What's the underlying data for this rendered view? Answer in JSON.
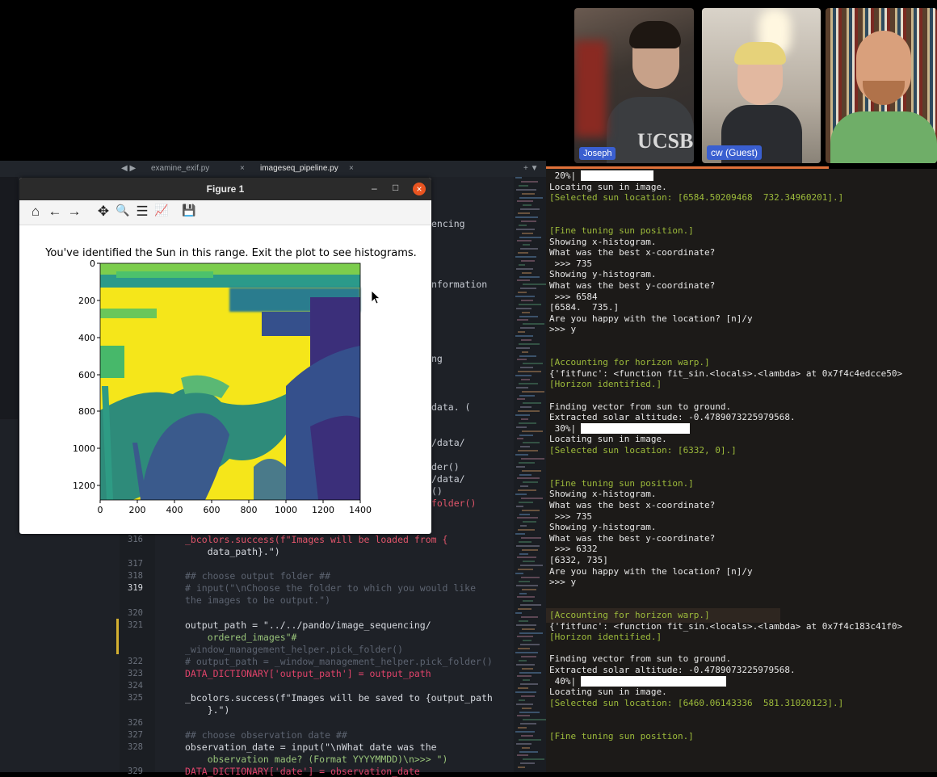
{
  "video_call": {
    "participants": [
      {
        "name": "Joseph"
      },
      {
        "name": "cw (Guest)"
      },
      {
        "name": ""
      }
    ],
    "shirt_text": "UCSB"
  },
  "editor": {
    "tabs": [
      {
        "label": "examine_exif.py",
        "close": "×"
      },
      {
        "label": "imageseq_pipeline.py",
        "close": "×"
      }
    ],
    "tab_nav": "◀ ▶",
    "tab_actions": "+ ▼",
    "fragments": [
      "encing",
      "nformation",
      "ng",
      "data. (",
      "/data/",
      "der()",
      "/data/",
      "()",
      "folder()"
    ],
    "lines": [
      {
        "num": "316",
        "code": "_bcolors.success(f\"Images will be loaded from {"
      },
      {
        "num": "",
        "code": "    data_path}.\")"
      },
      {
        "num": "317",
        "code": ""
      },
      {
        "num": "318",
        "code": "## choose output folder ##"
      },
      {
        "num": "319",
        "code": "# input(\"\\nChoose the folder to which you would like"
      },
      {
        "num": "",
        "code": "the images to be output.\")"
      },
      {
        "num": "320",
        "code": ""
      },
      {
        "num": "321",
        "code": "output_path = \"../../pando/image_sequencing/"
      },
      {
        "num": "",
        "code": "    ordered_images\"#"
      },
      {
        "num": "",
        "code": "_window_management_helper.pick_folder()"
      },
      {
        "num": "322",
        "code": "# output_path = _window_management_helper.pick_folder()"
      },
      {
        "num": "323",
        "code": "DATA_DICTIONARY['output_path'] = output_path"
      },
      {
        "num": "324",
        "code": ""
      },
      {
        "num": "325",
        "code": "_bcolors.success(f\"Images will be saved to {output_path"
      },
      {
        "num": "",
        "code": "    }.\")"
      },
      {
        "num": "326",
        "code": ""
      },
      {
        "num": "327",
        "code": "## choose observation date ##"
      },
      {
        "num": "328",
        "code": "observation_date = input(\"\\nWhat date was the"
      },
      {
        "num": "",
        "code": "    observation made? (Format YYYYMMDD)\\n>>> \")"
      },
      {
        "num": "329",
        "code": "DATA_DICTIONARY['date'] = observation_date"
      }
    ]
  },
  "figure": {
    "window_title": "Figure 1",
    "controls": {
      "minimize": "–",
      "maximize": "□",
      "close": "×"
    },
    "toolbar": [
      {
        "name": "home-icon",
        "glyph": "⌂"
      },
      {
        "name": "back-icon",
        "glyph": "←"
      },
      {
        "name": "forward-icon",
        "glyph": "→"
      },
      {
        "name": "pan-icon",
        "glyph": "✥"
      },
      {
        "name": "zoom-icon",
        "glyph": "🔍"
      },
      {
        "name": "configure-subplots-icon",
        "glyph": "☰"
      },
      {
        "name": "edit-axis-icon",
        "glyph": "📈"
      },
      {
        "name": "save-icon",
        "glyph": "💾"
      }
    ],
    "plot_title": "You've identified the Sun in this range. Exit the plot to see histograms.",
    "x_ticks": [
      "0",
      "200",
      "400",
      "600",
      "800",
      "1000",
      "1200",
      "1400"
    ],
    "y_ticks": [
      "0",
      "200",
      "400",
      "600",
      "800",
      "1000",
      "1200"
    ]
  },
  "terminal": {
    "lines": [
      {
        "text": " 20%|",
        "type": "progress",
        "percent": 20
      },
      {
        "text": "Locating sun in image.",
        "type": "normal"
      },
      {
        "text": "[Selected sun location: [6584.50209468  732.34960201].]",
        "type": "green"
      },
      {
        "text": "",
        "type": "normal"
      },
      {
        "text": "",
        "type": "normal"
      },
      {
        "text": "[Fine tuning sun position.]",
        "type": "green"
      },
      {
        "text": "Showing x-histogram.",
        "type": "normal"
      },
      {
        "text": "What was the best x-coordinate?",
        "type": "normal"
      },
      {
        "text": " >>> 735",
        "type": "normal"
      },
      {
        "text": "Showing y-histogram.",
        "type": "normal"
      },
      {
        "text": "What was the best y-coordinate?",
        "type": "normal"
      },
      {
        "text": " >>> 6584",
        "type": "normal"
      },
      {
        "text": "[6584.  735.]",
        "type": "normal"
      },
      {
        "text": "Are you happy with the location? [n]/y",
        "type": "normal"
      },
      {
        "text": ">>> y",
        "type": "normal"
      },
      {
        "text": "",
        "type": "normal"
      },
      {
        "text": "",
        "type": "normal"
      },
      {
        "text": "[Accounting for horizon warp.]",
        "type": "green"
      },
      {
        "text": "{'fitfunc': <function fit_sin.<locals>.<lambda> at 0x7f4c4edcce50>",
        "type": "normal"
      },
      {
        "text": "[Horizon identified.]",
        "type": "green"
      },
      {
        "text": "",
        "type": "normal"
      },
      {
        "text": "Finding vector from sun to ground.",
        "type": "normal"
      },
      {
        "text": "Extracted solar altitude: -0.4789073225979568.",
        "type": "normal"
      },
      {
        "text": " 30%|",
        "type": "progress",
        "percent": 30
      },
      {
        "text": "Locating sun in image.",
        "type": "normal"
      },
      {
        "text": "[Selected sun location: [6332, 0].]",
        "type": "green"
      },
      {
        "text": "",
        "type": "normal"
      },
      {
        "text": "",
        "type": "normal"
      },
      {
        "text": "[Fine tuning sun position.]",
        "type": "green"
      },
      {
        "text": "Showing x-histogram.",
        "type": "normal"
      },
      {
        "text": "What was the best x-coordinate?",
        "type": "normal"
      },
      {
        "text": " >>> 735",
        "type": "normal"
      },
      {
        "text": "Showing y-histogram.",
        "type": "normal"
      },
      {
        "text": "What was the best y-coordinate?",
        "type": "normal"
      },
      {
        "text": " >>> 6332",
        "type": "normal"
      },
      {
        "text": "[6332, 735]",
        "type": "normal"
      },
      {
        "text": "Are you happy with the location? [n]/y",
        "type": "normal"
      },
      {
        "text": ">>> y",
        "type": "normal"
      },
      {
        "text": "",
        "type": "normal"
      },
      {
        "text": "",
        "type": "normal"
      },
      {
        "text": "[Accounting for horizon warp.]",
        "type": "green"
      },
      {
        "text": "{'fitfunc': <function fit_sin.<locals>.<lambda> at 0x7f4c183c41f0>",
        "type": "normal"
      },
      {
        "text": "[Horizon identified.]",
        "type": "green"
      },
      {
        "text": "",
        "type": "normal"
      },
      {
        "text": "Finding vector from sun to ground.",
        "type": "normal"
      },
      {
        "text": "Extracted solar altitude: -0.4789073225979568.",
        "type": "normal"
      },
      {
        "text": " 40%|",
        "type": "progress",
        "percent": 40
      },
      {
        "text": "Locating sun in image.",
        "type": "normal"
      },
      {
        "text": "[Selected sun location: [6460.06143336  581.31020123].]",
        "type": "green"
      },
      {
        "text": "",
        "type": "normal"
      },
      {
        "text": "",
        "type": "normal"
      },
      {
        "text": "[Fine tuning sun position.]",
        "type": "green"
      }
    ]
  },
  "colors": {
    "terminal_green": "#9dbb3b",
    "accent_orange": "#e0713a",
    "viridis_yellow": "#f5e61a",
    "viridis_dark": "#3b2f7a"
  }
}
